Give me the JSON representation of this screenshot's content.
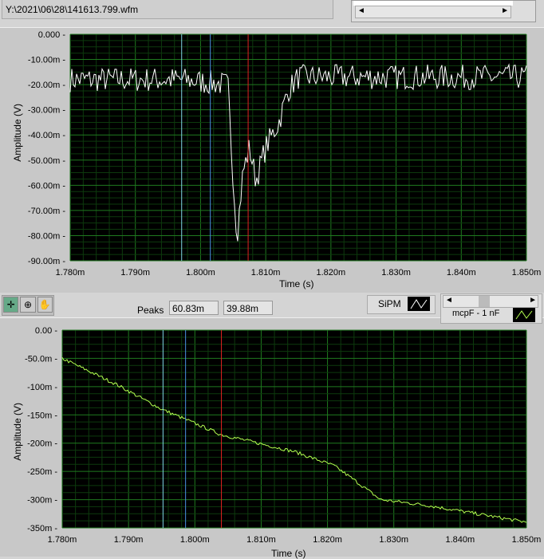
{
  "file_path": "Y:\\2021\\06\\28\\141613.799.wfm",
  "scroll_left": "◄",
  "scroll_right": "►",
  "peaks": {
    "label": "Peaks",
    "value1": "60.83m",
    "value2": "39.88m"
  },
  "legend": {
    "sipm": "SiPM",
    "mcp": "mcpF - 1 nF"
  },
  "colors": {
    "plot_bg": "#000000",
    "grid_major": "#1f7a1f",
    "grid_minor": "#0d3a0d",
    "top_trace": "#ffffff",
    "bottom_trace": "#b4ff50",
    "cursor_cyan": "#7fd4e6",
    "cursor_blue": "#4a90e2",
    "cursor_red": "#e02020"
  },
  "chart_data": [
    {
      "type": "line",
      "title": "",
      "xlabel": "Time (s)",
      "ylabel": "Amplitude (V)",
      "xlim": [
        1.78,
        1.85
      ],
      "ylim": [
        -90,
        0
      ],
      "xticks": [
        "1.780m",
        "1.790m",
        "1.800m",
        "1.810m",
        "1.820m",
        "1.830m",
        "1.840m",
        "1.850m"
      ],
      "yticks": [
        "0.000",
        "-10.00m",
        "-20.00m",
        "-30.00m",
        "-40.00m",
        "-50.00m",
        "-60.00m",
        "-70.00m",
        "-80.00m",
        "-90.00m"
      ],
      "series": [
        {
          "name": "SiPM",
          "x": [
            1.78,
            1.797,
            1.8042,
            1.8046,
            1.8052,
            1.8056,
            1.8065,
            1.8075,
            1.8085,
            1.81,
            1.812,
            1.8135,
            1.815,
            1.85
          ],
          "y": [
            -18,
            -18,
            -20,
            -40,
            -65,
            -80,
            -55,
            -45,
            -58,
            -45,
            -35,
            -22,
            -17,
            -17
          ],
          "noise": 5
        }
      ],
      "cursors": [
        1.7971,
        1.8015,
        1.8073
      ]
    },
    {
      "type": "line",
      "title": "",
      "xlabel": "Time (s)",
      "ylabel": "Amplitude (V)",
      "xlim": [
        1.78,
        1.85
      ],
      "ylim": [
        -350,
        0
      ],
      "xticks": [
        "1.780m",
        "1.790m",
        "1.800m",
        "1.810m",
        "1.820m",
        "1.830m",
        "1.840m",
        "1.850m"
      ],
      "yticks": [
        "0.00",
        "-50.0m",
        "-100m",
        "-150m",
        "-200m",
        "-250m",
        "-300m",
        "-350m"
      ],
      "series": [
        {
          "name": "mcpF - 1 nF",
          "x": [
            1.78,
            1.788,
            1.795,
            1.804,
            1.815,
            1.821,
            1.824,
            1.828,
            1.835,
            1.845,
            1.85
          ],
          "y": [
            -50,
            -95,
            -140,
            -185,
            -215,
            -240,
            -265,
            -300,
            -310,
            -330,
            -340
          ],
          "noise": 3
        }
      ],
      "cursors": [
        1.7952,
        1.7986,
        1.804
      ]
    }
  ]
}
